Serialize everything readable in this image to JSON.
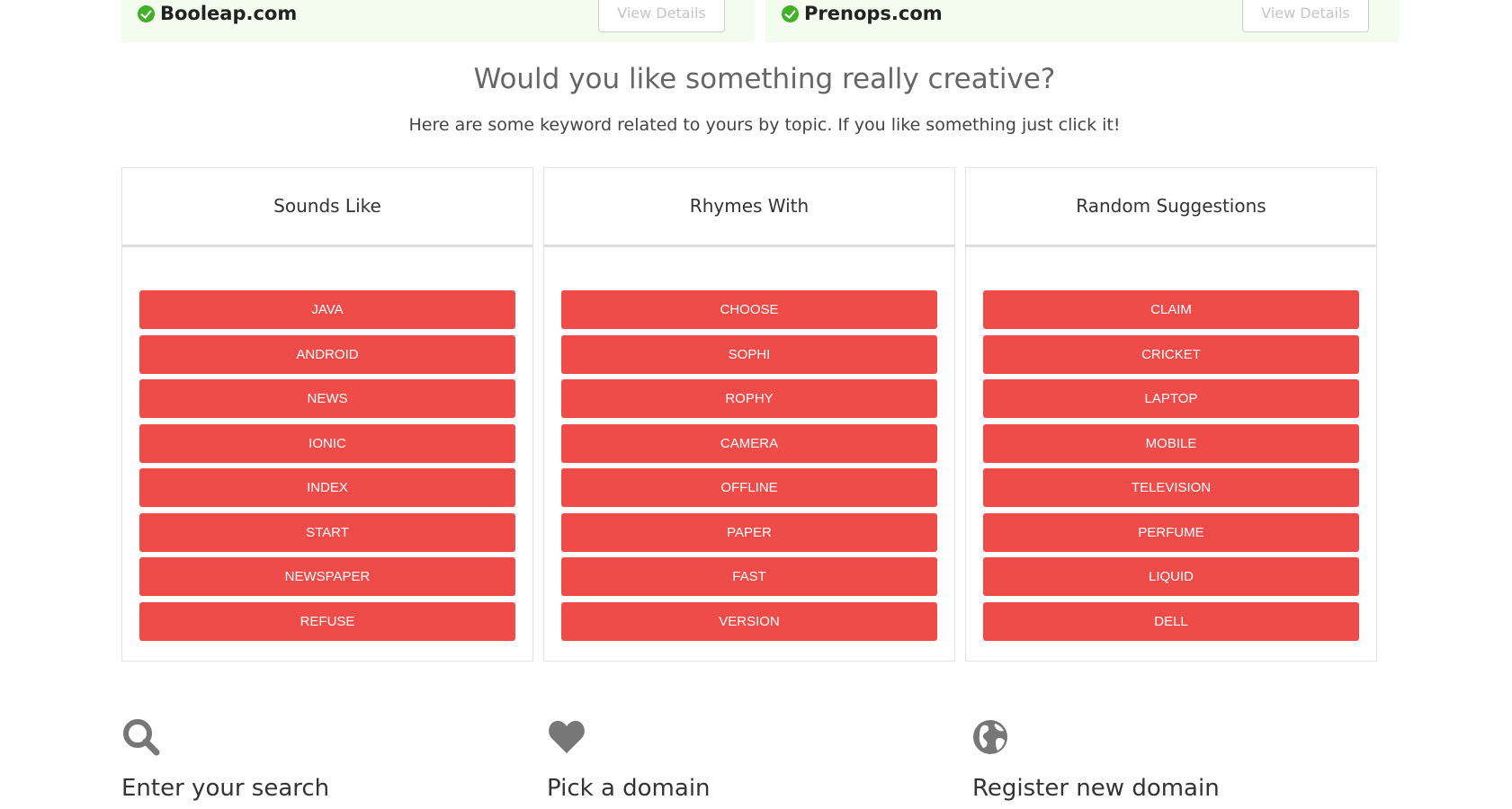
{
  "results": [
    {
      "domain": "Booleap.com",
      "button": "View Details"
    },
    {
      "domain": "Prenops.com",
      "button": "View Details"
    }
  ],
  "creative": {
    "title": "Would you like something really creative?",
    "subtitle": "Here are some keyword related to yours by topic. If you like something just click it!"
  },
  "panels": [
    {
      "title": "Sounds Like",
      "keywords": [
        "JAVA",
        "ANDROID",
        "NEWS",
        "IONIC",
        "INDEX",
        "START",
        "NEWSPAPER",
        "REFUSE"
      ]
    },
    {
      "title": "Rhymes With",
      "keywords": [
        "CHOOSE",
        "SOPHI",
        "ROPHY",
        "CAMERA",
        "OFFLINE",
        "PAPER",
        "FAST",
        "VERSION"
      ]
    },
    {
      "title": "Random Suggestions",
      "keywords": [
        "CLAIM",
        "CRICKET",
        "LAPTOP",
        "MOBILE",
        "TELEVISION",
        "PERFUME",
        "LIQUID",
        "DELL"
      ]
    }
  ],
  "steps": [
    {
      "icon": "search-icon",
      "title": "Enter your search"
    },
    {
      "icon": "heart-icon",
      "title": "Pick a domain"
    },
    {
      "icon": "globe-icon",
      "title": "Register new domain"
    }
  ],
  "colors": {
    "keyword_button": "#ef4c49",
    "result_bg": "#f3fcef",
    "check": "#43b02a",
    "icon_gray": "#777777"
  }
}
